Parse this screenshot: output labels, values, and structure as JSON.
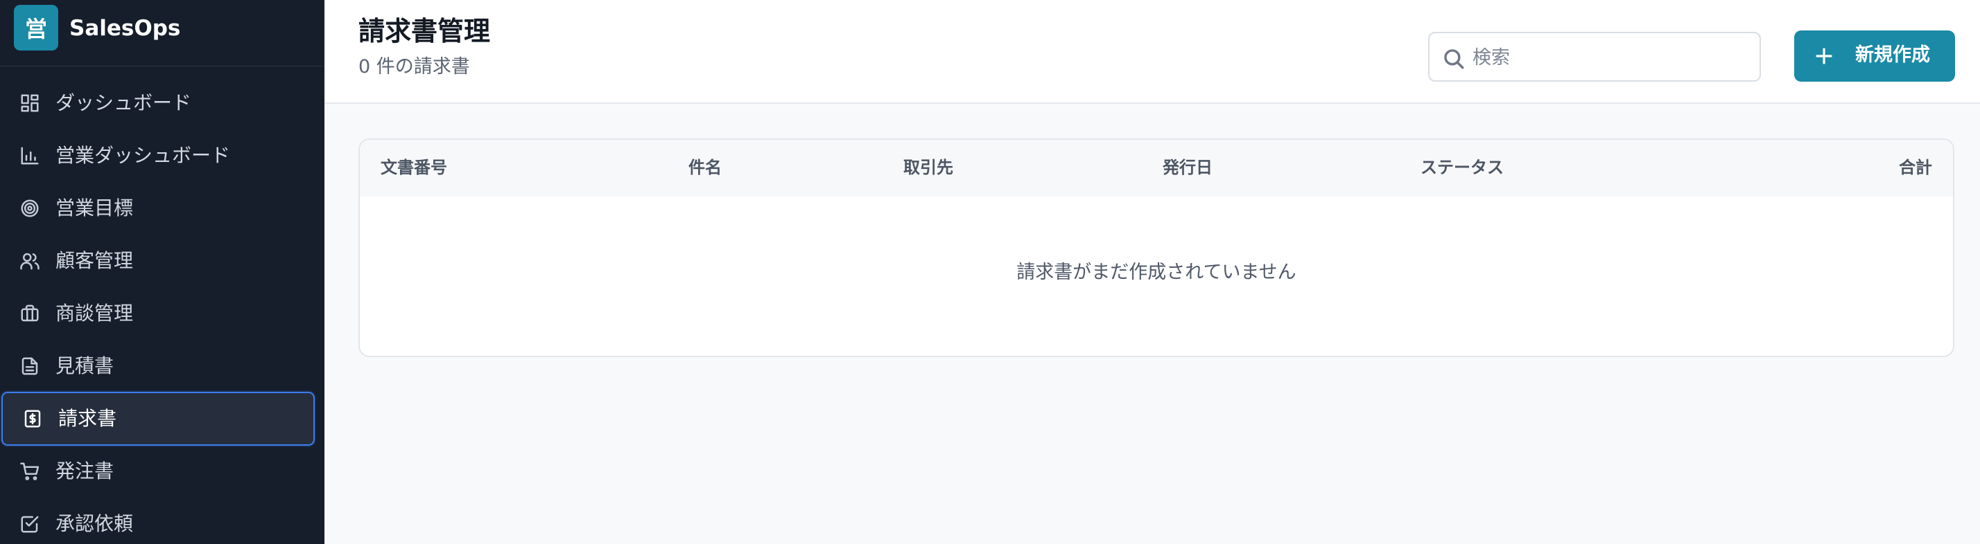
{
  "brand": {
    "logo_char": "営",
    "name": "SalesOps"
  },
  "sidebar": {
    "items": [
      {
        "label": "ダッシュボード",
        "icon": "dashboard-icon"
      },
      {
        "label": "営業ダッシュボード",
        "icon": "bar-chart-icon"
      },
      {
        "label": "営業目標",
        "icon": "target-icon"
      },
      {
        "label": "顧客管理",
        "icon": "users-icon"
      },
      {
        "label": "商談管理",
        "icon": "briefcase-icon"
      },
      {
        "label": "見積書",
        "icon": "document-icon"
      },
      {
        "label": "請求書",
        "icon": "invoice-icon",
        "active": true
      },
      {
        "label": "発注書",
        "icon": "cart-icon"
      },
      {
        "label": "承認依頼",
        "icon": "check-square-icon"
      }
    ]
  },
  "header": {
    "title": "請求書管理",
    "subtitle": "0 件の請求書",
    "search_placeholder": "検索",
    "new_button_label": "新規作成"
  },
  "table": {
    "columns": [
      "文書番号",
      "件名",
      "取引先",
      "発行日",
      "ステータス",
      "合計"
    ],
    "rows": [],
    "empty_message": "請求書がまだ作成されていません"
  },
  "colors": {
    "sidebar_bg": "#161e2b",
    "accent": "#1a8aa6",
    "active_border": "#3b7ef0"
  }
}
